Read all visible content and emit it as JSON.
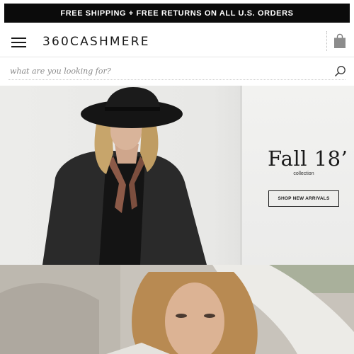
{
  "promo_banner": {
    "text": "FREE SHIPPING + FREE RETURNS ON ALL U.S. ORDERS"
  },
  "header": {
    "logo": "360CASHMERE",
    "menu_icon": "hamburger-menu-icon",
    "cart_icon": "shopping-bag-icon"
  },
  "search": {
    "placeholder": "what are you looking for?",
    "icon": "search-icon"
  },
  "hero": {
    "title": "Fall 18’",
    "subtitle": "collection",
    "cta_label": "SHOP NEW ARRIVALS"
  },
  "colors": {
    "promo_bg": "#0b0b0b",
    "promo_text": "#ffffff",
    "text": "#1a1a1a"
  }
}
